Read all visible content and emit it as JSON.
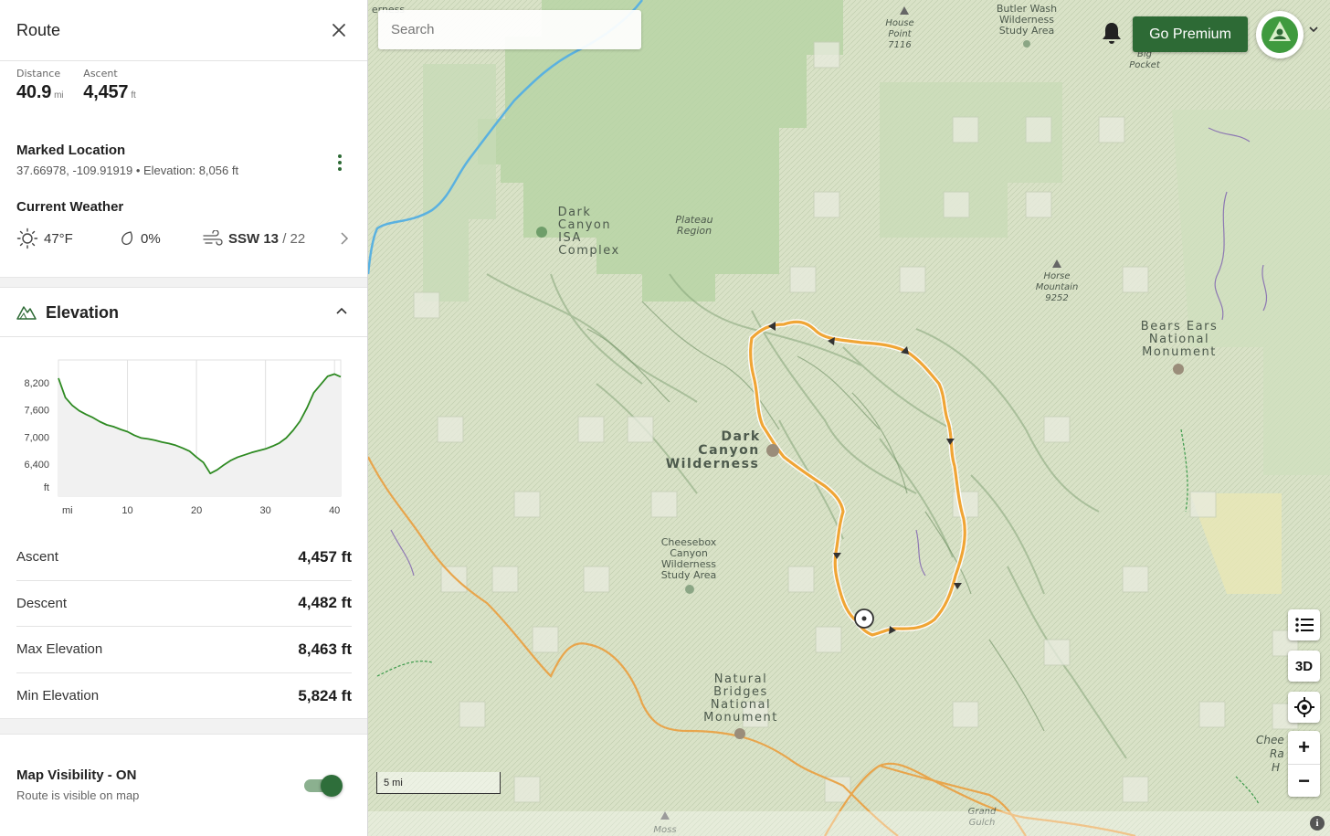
{
  "panel": {
    "title": "Route",
    "stats": [
      {
        "label": "Distance",
        "value": "40.9",
        "unit": "mi"
      },
      {
        "label": "Ascent",
        "value": "4,457",
        "unit": "ft"
      }
    ],
    "marked_location": {
      "title": "Marked Location",
      "details": "37.66978, -109.91919 • Elevation: 8,056 ft"
    },
    "weather": {
      "title": "Current Weather",
      "temp": "47°F",
      "precip": "0%",
      "wind_dir": "SSW 13",
      "wind_sep": "/",
      "wind_gust": "22"
    },
    "elevation": {
      "title": "Elevation",
      "table": [
        {
          "label": "Ascent",
          "value": "4,457 ft"
        },
        {
          "label": "Descent",
          "value": "4,482 ft"
        },
        {
          "label": "Max Elevation",
          "value": "8,463 ft"
        },
        {
          "label": "Min Elevation",
          "value": "5,824 ft"
        }
      ]
    },
    "visibility": {
      "title": "Map Visibility - ON",
      "subtitle": "Route is visible on map",
      "on": true
    }
  },
  "chart_data": {
    "type": "line",
    "xlabel": "mi",
    "ylabel": "ft",
    "xlim": [
      0,
      40.9
    ],
    "ylim": [
      5700,
      8700
    ],
    "x_ticks": [
      10,
      20,
      30,
      40
    ],
    "y_ticks": [
      6400,
      7000,
      7600,
      8200
    ],
    "y_tick_labels": [
      "6,400",
      "7,000",
      "7,600",
      "8,200"
    ],
    "x": [
      0,
      1,
      2,
      3,
      4,
      5,
      6,
      7,
      8,
      9,
      10,
      11,
      12,
      13,
      14,
      15,
      16,
      17,
      18,
      19,
      20,
      21,
      22,
      23,
      24,
      25,
      26,
      27,
      28,
      29,
      30,
      31,
      32,
      33,
      34,
      35,
      36,
      37,
      38,
      39,
      40,
      40.9
    ],
    "y": [
      8300,
      7870,
      7700,
      7580,
      7500,
      7430,
      7340,
      7270,
      7230,
      7170,
      7120,
      7040,
      6980,
      6960,
      6930,
      6890,
      6860,
      6820,
      6760,
      6690,
      6560,
      6440,
      6200,
      6280,
      6390,
      6490,
      6560,
      6610,
      6660,
      6700,
      6740,
      6800,
      6870,
      6980,
      7150,
      7350,
      7640,
      7980,
      8160,
      8340,
      8390,
      8330
    ],
    "color": "#2e8a22"
  },
  "map": {
    "search_placeholder": "Search",
    "premium_label": "Go Premium",
    "button_3d": "3D",
    "zoom_in": "+",
    "zoom_out": "−",
    "scale_label": "5 mi",
    "info": "i",
    "route_color": "#f0a535",
    "labels": {
      "dark_canyon_isa": [
        "Dark",
        "Canyon",
        "ISA",
        "Complex"
      ],
      "plateau_region": [
        "Plateau",
        "Region"
      ],
      "dark_canyon_wilderness": [
        "Dark",
        "Canyon",
        "Wilderness"
      ],
      "cheesebox": [
        "Cheesebox",
        "Canyon",
        "Wilderness",
        "Study Area"
      ],
      "natural_bridges": [
        "Natural",
        "Bridges",
        "National",
        "Monument"
      ],
      "bears_ears": [
        "Bears Ears",
        "National",
        "Monument"
      ],
      "horse_mountain": [
        "Horse",
        "Mountain",
        "9252"
      ],
      "house_point": [
        "House",
        "Point",
        "7116"
      ],
      "butler_wash": [
        "Butler Wash",
        "Wilderness",
        "Study Area"
      ],
      "big_pocket": [
        "Big",
        "Pocket"
      ],
      "wilderness_top": "erness",
      "cheese_right": [
        "Chee",
        "Ra",
        "H"
      ],
      "grand_gulch": [
        "Grand",
        "Gulch"
      ],
      "moss": "Moss"
    }
  }
}
